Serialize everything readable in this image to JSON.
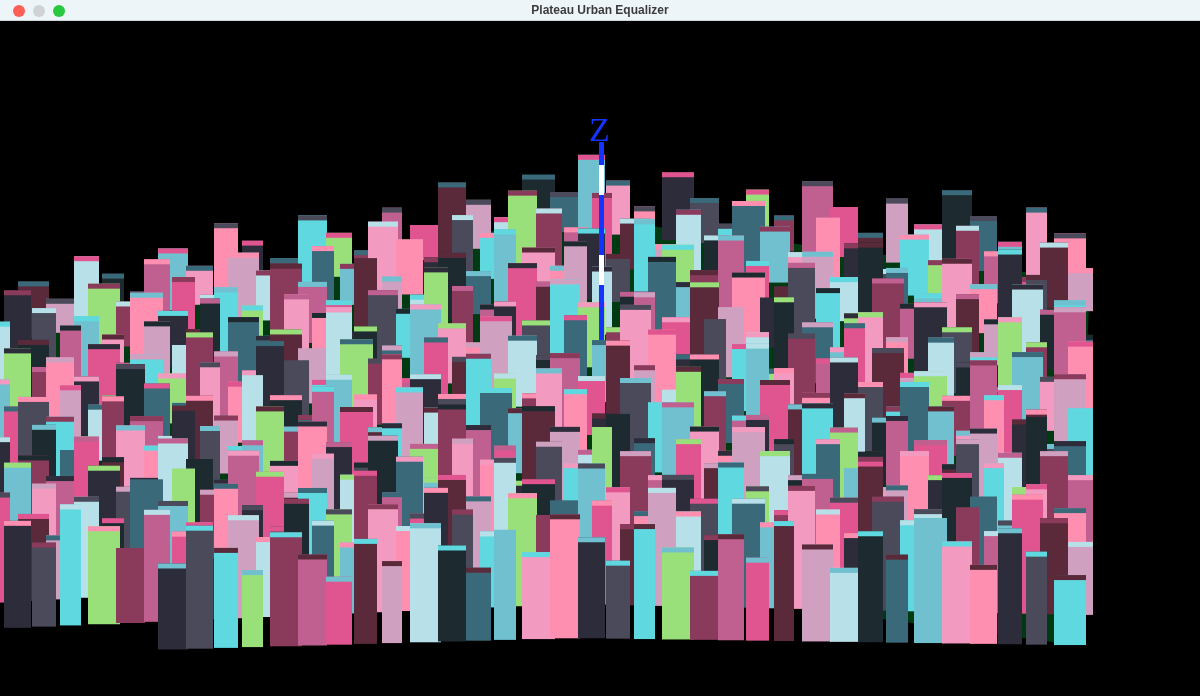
{
  "window": {
    "title": "Plateau Urban Equalizer",
    "controls": [
      {
        "kind": "close",
        "disabled": false
      },
      {
        "kind": "minimize",
        "disabled": true
      },
      {
        "kind": "zoom",
        "disabled": false
      }
    ]
  },
  "viewport": {
    "axis_label": "Z"
  }
}
